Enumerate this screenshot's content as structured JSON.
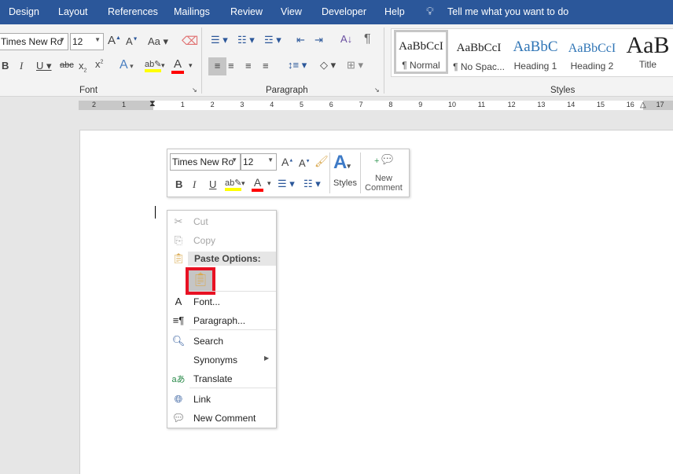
{
  "tabs": [
    "Design",
    "Layout",
    "References",
    "Mailings",
    "Review",
    "View",
    "Developer",
    "Help"
  ],
  "tell_me": "Tell me what you want to do",
  "ribbon": {
    "font_name": "Times New Ro",
    "font_size": "12",
    "font_group": "Font",
    "paragraph_group": "Paragraph",
    "styles_group": "Styles",
    "styles": [
      {
        "preview": "AaBbCcI",
        "name": "¶ Normal"
      },
      {
        "preview": "AaBbCcI",
        "name": "¶ No Spac..."
      },
      {
        "preview": "AaBbC",
        "name": "Heading 1"
      },
      {
        "preview": "AaBbCcI",
        "name": "Heading 2"
      },
      {
        "preview": "AaB",
        "name": "Title"
      }
    ],
    "colors": {
      "highlight": "#ffff00",
      "font_color": "#ff0000"
    }
  },
  "ruler": {
    "left": [
      "2",
      "1"
    ],
    "right": [
      "1",
      "2",
      "3",
      "4",
      "5",
      "6",
      "7",
      "8",
      "9",
      "10",
      "11",
      "12",
      "13",
      "14",
      "15",
      "16",
      "17"
    ]
  },
  "mini_toolbar": {
    "font_name": "Times New Ro",
    "font_size": "12",
    "bold": "B",
    "italic": "I",
    "underline": "U",
    "styles_label": "Styles",
    "new_comment_label": "New Comment"
  },
  "context_menu": {
    "cut": "Cut",
    "copy": "Copy",
    "paste_options": "Paste Options:",
    "font": "Font...",
    "paragraph": "Paragraph...",
    "search": "Search",
    "synonyms": "Synonyms",
    "translate": "Translate",
    "link": "Link",
    "new_comment": "New Comment"
  }
}
